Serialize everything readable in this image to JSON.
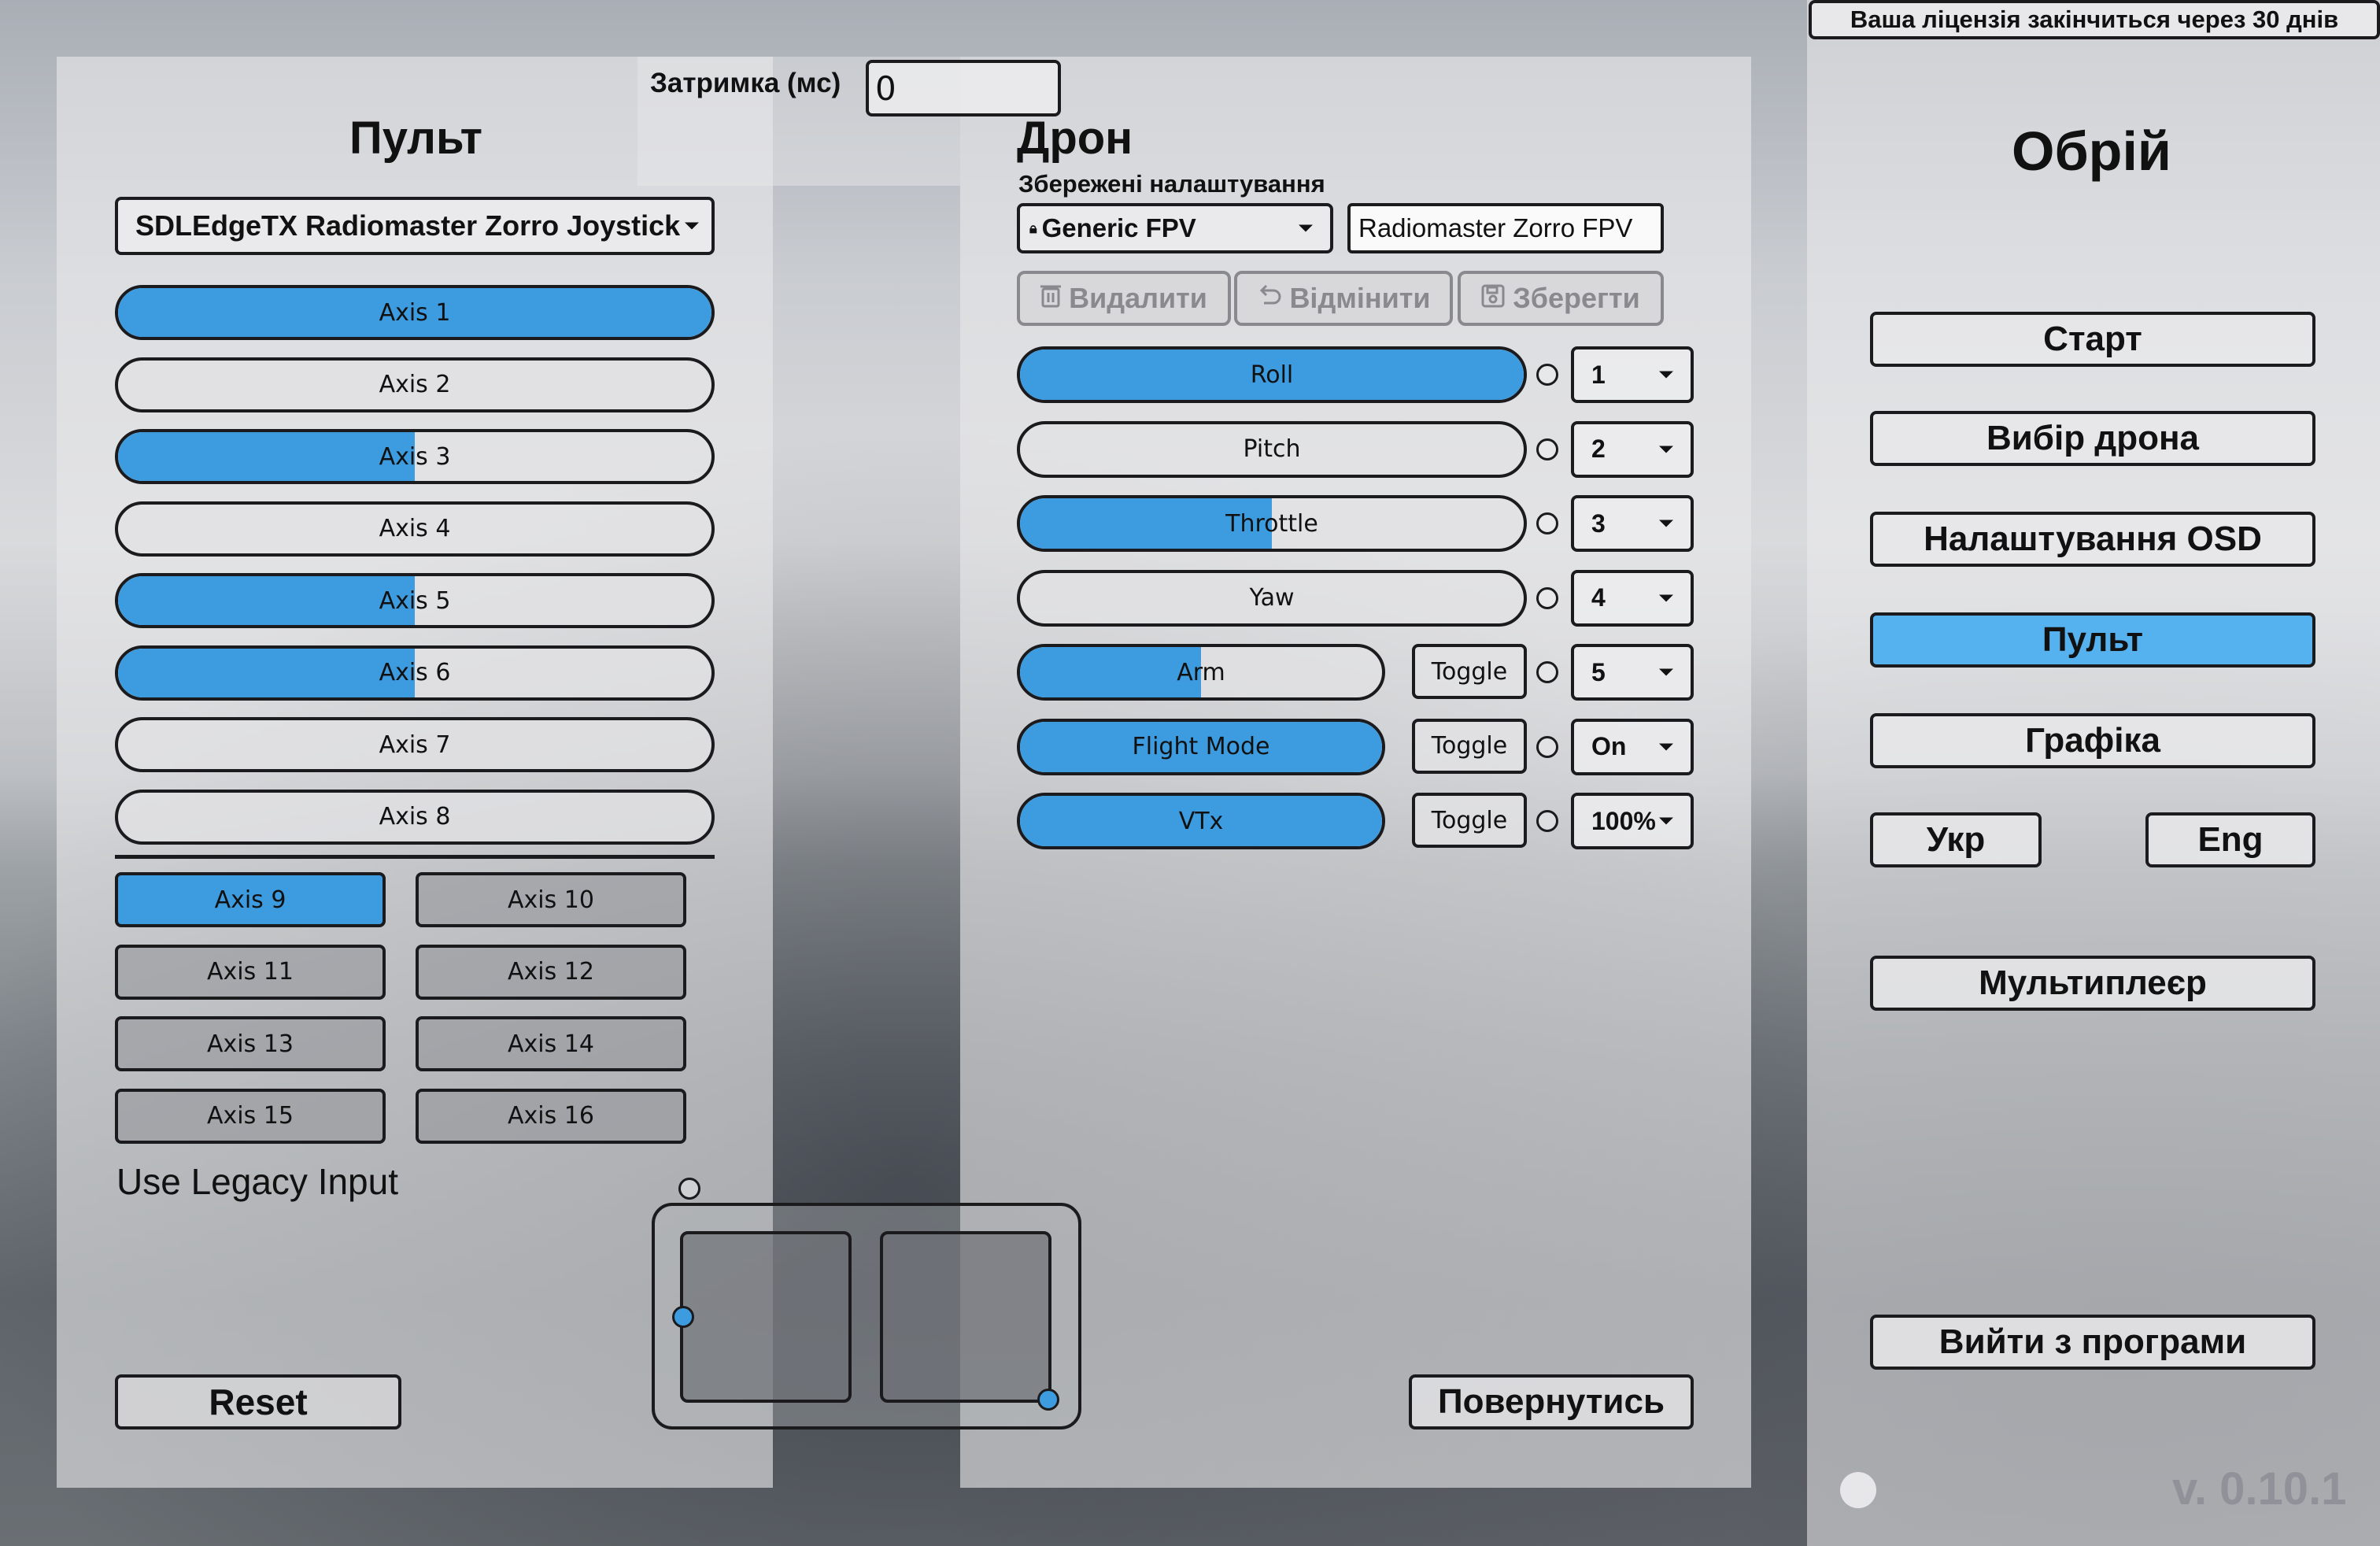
{
  "license_notice": "Ваша ліцензія закінчиться через 30 днів",
  "delay": {
    "label": "Затримка (мс)",
    "value": "0"
  },
  "remote": {
    "title": "Пульт",
    "device": "SDLEdgeTX Radiomaster Zorro Joystick",
    "axes": [
      {
        "label": "Axis 1",
        "level": 1.0
      },
      {
        "label": "Axis 2",
        "level": 0.0
      },
      {
        "label": "Axis 3",
        "level": 0.5
      },
      {
        "label": "Axis 4",
        "level": 0.0
      },
      {
        "label": "Axis 5",
        "level": 0.5
      },
      {
        "label": "Axis 6",
        "level": 0.5
      },
      {
        "label": "Axis 7",
        "level": 0.0
      },
      {
        "label": "Axis 8",
        "level": 0.0
      }
    ],
    "buttons": [
      {
        "label": "Axis 9",
        "active": true
      },
      {
        "label": "Axis 10",
        "active": false
      },
      {
        "label": "Axis 11",
        "active": false
      },
      {
        "label": "Axis 12",
        "active": false
      },
      {
        "label": "Axis 13",
        "active": false
      },
      {
        "label": "Axis 14",
        "active": false
      },
      {
        "label": "Axis 15",
        "active": false
      },
      {
        "label": "Axis 16",
        "active": false
      }
    ],
    "legacy_label": "Use Legacy Input",
    "reset_label": "Reset"
  },
  "drone": {
    "title": "Дрон",
    "saved_label": "Збережені налаштування",
    "preset": "Generic FPV",
    "preset_name": "Radiomaster Zorro FPV",
    "actions": {
      "delete": "Видалити",
      "cancel": "Відмінити",
      "save": "Зберегти"
    },
    "channels": [
      {
        "label": "Roll",
        "level": 1.0,
        "value": "1"
      },
      {
        "label": "Pitch",
        "level": 0.0,
        "value": "2"
      },
      {
        "label": "Throttle",
        "level": 0.5,
        "value": "3"
      },
      {
        "label": "Yaw",
        "level": 0.0,
        "value": "4"
      },
      {
        "label": "Arm",
        "level": 0.5,
        "toggle": "Toggle",
        "value": "5"
      },
      {
        "label": "Flight Mode",
        "level": 1.0,
        "toggle": "Toggle",
        "value": "On"
      },
      {
        "label": "VTx",
        "level": 1.0,
        "toggle": "Toggle",
        "value": "100%"
      }
    ],
    "back_label": "Повернутись"
  },
  "sticks": {
    "left": {
      "x": 0.0,
      "y": 0.5
    },
    "right": {
      "x": 1.0,
      "y": 1.0
    }
  },
  "sidebar": {
    "title": "Обрій",
    "start": "Старт",
    "drone_select": "Вибір дрона",
    "osd": "Налаштування OSD",
    "remote": "Пульт",
    "graphics": "Графіка",
    "ukr": "Укр",
    "eng": "Eng",
    "multiplayer": "Мультиплеєр",
    "exit": "Вийти з програми",
    "version": "v. 0.10.1"
  },
  "colors": {
    "accent": "#3d9be0",
    "active_nav": "#55b2ee"
  }
}
